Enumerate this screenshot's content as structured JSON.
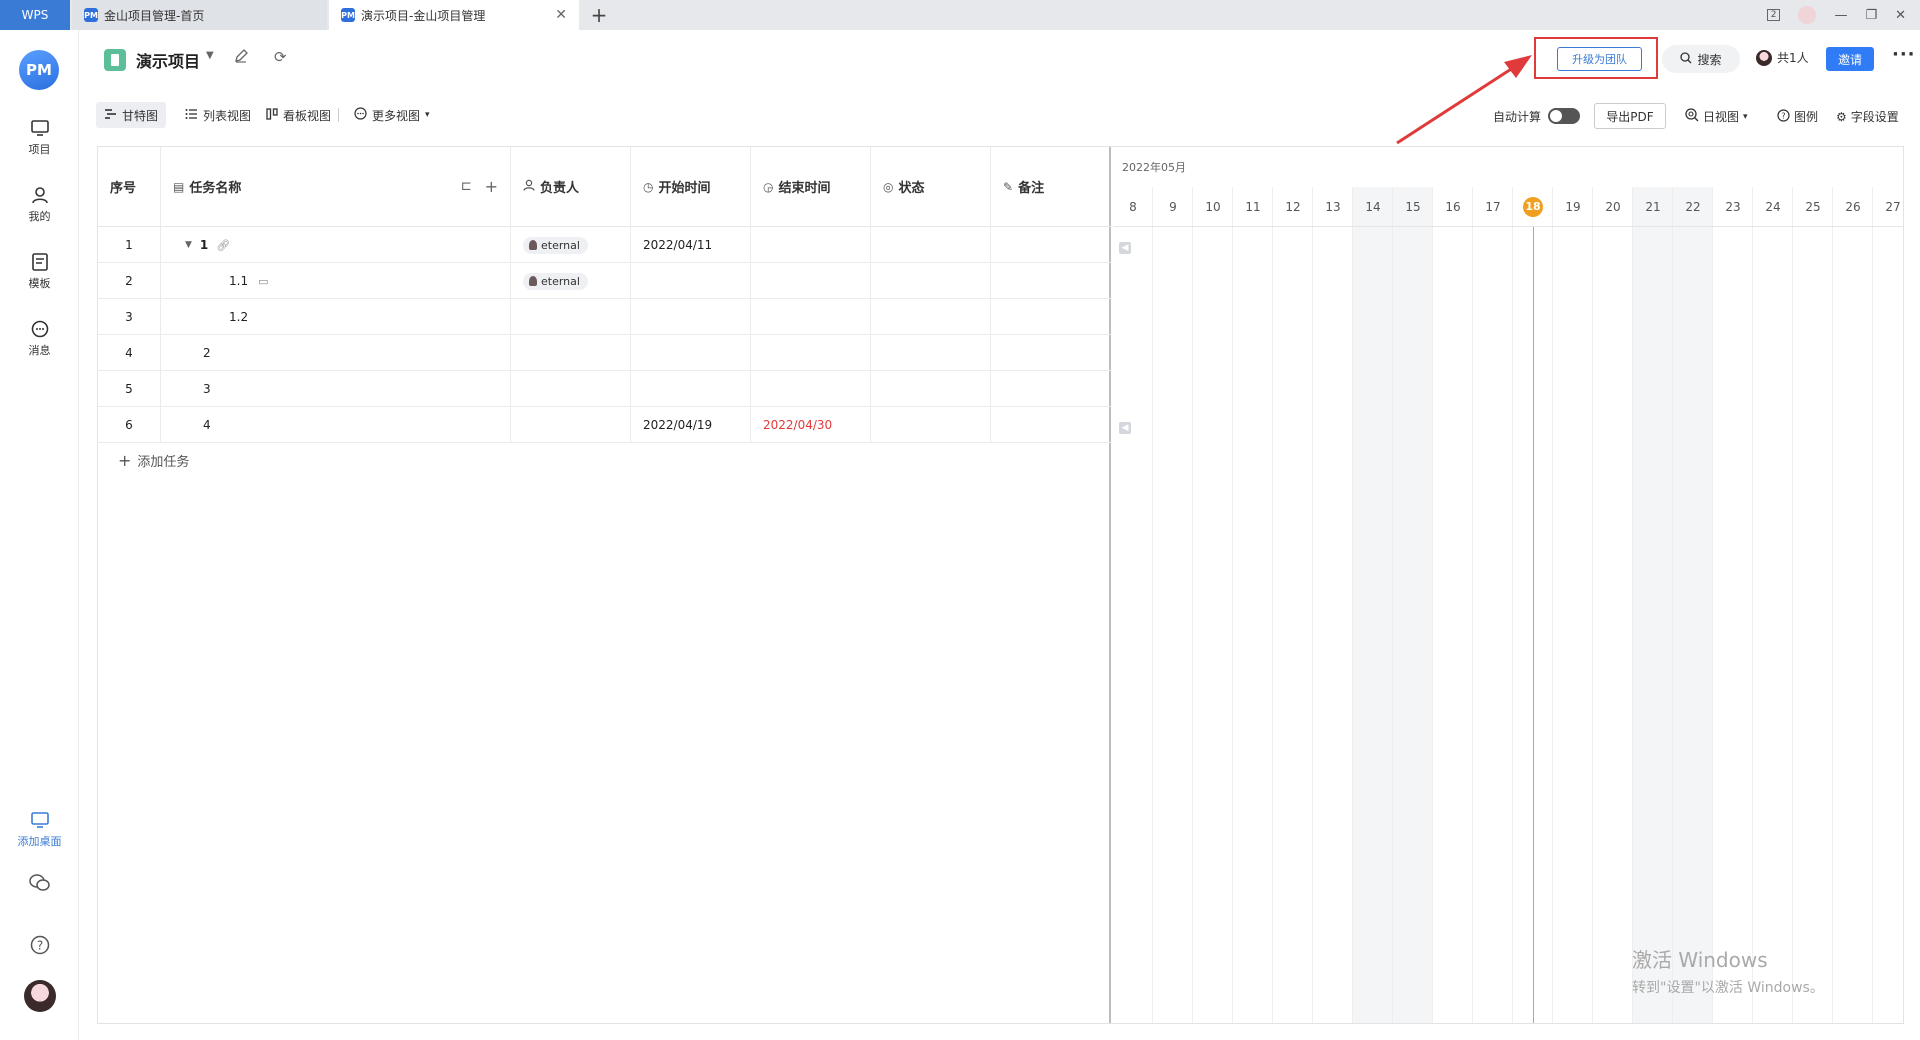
{
  "titlebar": {
    "brand": "WPS",
    "tabs": [
      {
        "label": "金山项目管理-首页"
      },
      {
        "label": "演示项目-金山项目管理"
      }
    ],
    "new_tab": "+",
    "window_count": "2"
  },
  "sidebar": {
    "logo": "PM",
    "items": [
      {
        "label": "项目"
      },
      {
        "label": "我的"
      },
      {
        "label": "模板"
      },
      {
        "label": "消息"
      }
    ],
    "add_desktop": "添加桌面"
  },
  "header": {
    "project_title": "演示项目",
    "upgrade_label": "升级为团队",
    "search_label": "搜索",
    "members_label": "共1人",
    "invite_label": "邀请",
    "more": "···"
  },
  "toolbar": {
    "views": [
      {
        "label": "甘特图"
      },
      {
        "label": "列表视图"
      },
      {
        "label": "看板视图"
      },
      {
        "label": "更多视图"
      }
    ],
    "auto_calc": "自动计算",
    "auto_calc_on": false,
    "export_pdf": "导出PDF",
    "day_view": "日视图",
    "legend": "图例",
    "field_settings": "字段设置"
  },
  "table": {
    "columns": [
      "序号",
      "任务名称",
      "负责人",
      "开始时间",
      "结束时间",
      "状态",
      "备注"
    ],
    "rows": [
      {
        "no": "1",
        "name": "1",
        "owner": "eternal",
        "start": "2022/04/11",
        "end": "",
        "status": "",
        "note": ""
      },
      {
        "no": "2",
        "name": "1.1",
        "owner": "eternal",
        "start": "",
        "end": "",
        "status": "",
        "note": ""
      },
      {
        "no": "3",
        "name": "1.2",
        "owner": "",
        "start": "",
        "end": "",
        "status": "",
        "note": ""
      },
      {
        "no": "4",
        "name": "2",
        "owner": "",
        "start": "",
        "end": "",
        "status": "",
        "note": ""
      },
      {
        "no": "5",
        "name": "3",
        "owner": "",
        "start": "",
        "end": "",
        "status": "",
        "note": ""
      },
      {
        "no": "6",
        "name": "4",
        "owner": "",
        "start": "2022/04/19",
        "end": "2022/04/30",
        "status": "",
        "note": ""
      }
    ],
    "add_task": "添加任务"
  },
  "gantt": {
    "month": "2022年05月",
    "days": [
      "8",
      "9",
      "10",
      "11",
      "12",
      "13",
      "14",
      "15",
      "16",
      "17",
      "18",
      "19",
      "20",
      "21",
      "22",
      "23",
      "24",
      "25",
      "26",
      "27"
    ],
    "weekends": [
      "14",
      "15",
      "21",
      "22"
    ],
    "today": "18"
  },
  "watermark": {
    "line1": "激活 Windows",
    "line2": "转到\"设置\"以激活 Windows。"
  },
  "colors": {
    "accent": "#2f7cf6",
    "highlight_red": "#e03a3a",
    "today": "#f0a020"
  }
}
